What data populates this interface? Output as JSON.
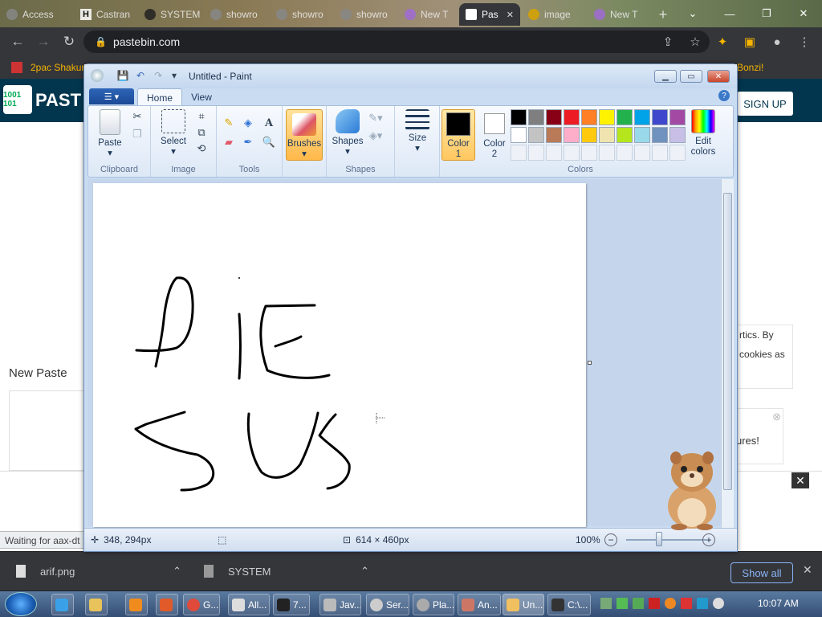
{
  "browser": {
    "tabs": [
      {
        "label": "Access"
      },
      {
        "label": "Castran"
      },
      {
        "label": "SYSTEM"
      },
      {
        "label": "showro"
      },
      {
        "label": "showro"
      },
      {
        "label": "showro"
      },
      {
        "label": "New T"
      },
      {
        "label": "Pas"
      },
      {
        "label": "image"
      },
      {
        "label": "New T"
      }
    ],
    "url": "pastebin.com",
    "bookmark": "2pac Shakur",
    "bookmark_right": "Bonzi!"
  },
  "pastebin": {
    "logo_text": "1001 101",
    "site_name": "PAST",
    "signup": "SIGN UP",
    "new_paste": "New Paste",
    "cookie_line1": "rtics. By",
    "cookie_line2": "cookies as",
    "features": "ures!",
    "waiting": "Waiting for aax-dt"
  },
  "paint": {
    "title": "Untitled - Paint",
    "tabs": {
      "home": "Home",
      "view": "View"
    },
    "groups": {
      "clipboard": "Clipboard",
      "image": "Image",
      "tools": "Tools",
      "shapes": "Shapes",
      "colors": "Colors"
    },
    "buttons": {
      "paste": "Paste",
      "select": "Select",
      "brushes": "Brushes",
      "shapes": "Shapes",
      "size": "Size",
      "color1": "Color",
      "color1_n": "1",
      "color2": "Color",
      "color2_n": "2",
      "edit_colors_1": "Edit",
      "edit_colors_2": "colors"
    },
    "palette_row1": [
      "#000000",
      "#7f7f7f",
      "#880015",
      "#ed1c24",
      "#ff7f27",
      "#fff200",
      "#22b14c",
      "#00a2e8",
      "#3f48cc",
      "#a349a4"
    ],
    "palette_row2": [
      "#ffffff",
      "#c3c3c3",
      "#b97a57",
      "#ffaec9",
      "#ffc90e",
      "#efe4b0",
      "#b5e61d",
      "#99d9ea",
      "#7092be",
      "#c8bfe7"
    ],
    "status": {
      "cursor": "348, 294px",
      "size": "614 × 460px",
      "zoom": "100%"
    },
    "drawing_words": [
      "DIE",
      "SUS"
    ]
  },
  "downloads": {
    "items": [
      {
        "label": "arif.png"
      },
      {
        "label": "SYSTEM"
      }
    ],
    "show_all": "Show all"
  },
  "taskbar": {
    "items": [
      "G...",
      "All...",
      "7...",
      "Jav...",
      "Ser...",
      "Pla...",
      "An...",
      "Un...",
      "C:\\..."
    ],
    "clock": "10:07 AM"
  }
}
